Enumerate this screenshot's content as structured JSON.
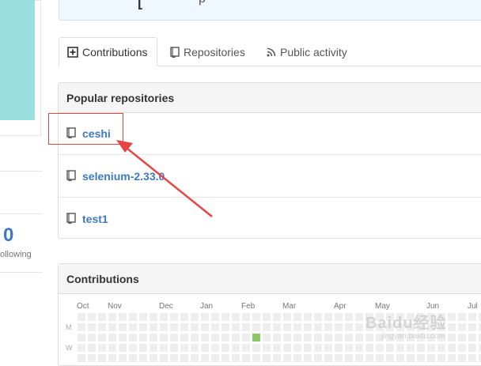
{
  "sidebar": {
    "stat_value": "0",
    "stat_label": "ollowing"
  },
  "banner": {
    "bracket": "[",
    "mark": "p"
  },
  "tabs": [
    {
      "label": "Contributions",
      "icon": "plus-box-icon",
      "active": true
    },
    {
      "label": "Repositories",
      "icon": "repo-icon",
      "active": false
    },
    {
      "label": "Public activity",
      "icon": "rss-icon",
      "active": false
    }
  ],
  "popular": {
    "title": "Popular repositories",
    "repos": [
      {
        "name": "ceshi",
        "icon": "repo-icon"
      },
      {
        "name": "selenium-2.33.0",
        "icon": "repo-icon"
      },
      {
        "name": "test1",
        "icon": "repo-icon"
      }
    ]
  },
  "contributions": {
    "title": "Contributions",
    "months": [
      "Oct",
      "Nov",
      "Dec",
      "Jan",
      "Feb",
      "Mar",
      "Apr",
      "May",
      "Jun",
      "Jul"
    ],
    "day_labels": [
      "M",
      "W"
    ],
    "highlight_color": "#8cc665"
  },
  "annotation": {
    "color": "#e64545"
  },
  "watermark": {
    "text": "Baidu经验",
    "sub": "jingyan.baidu.com"
  }
}
